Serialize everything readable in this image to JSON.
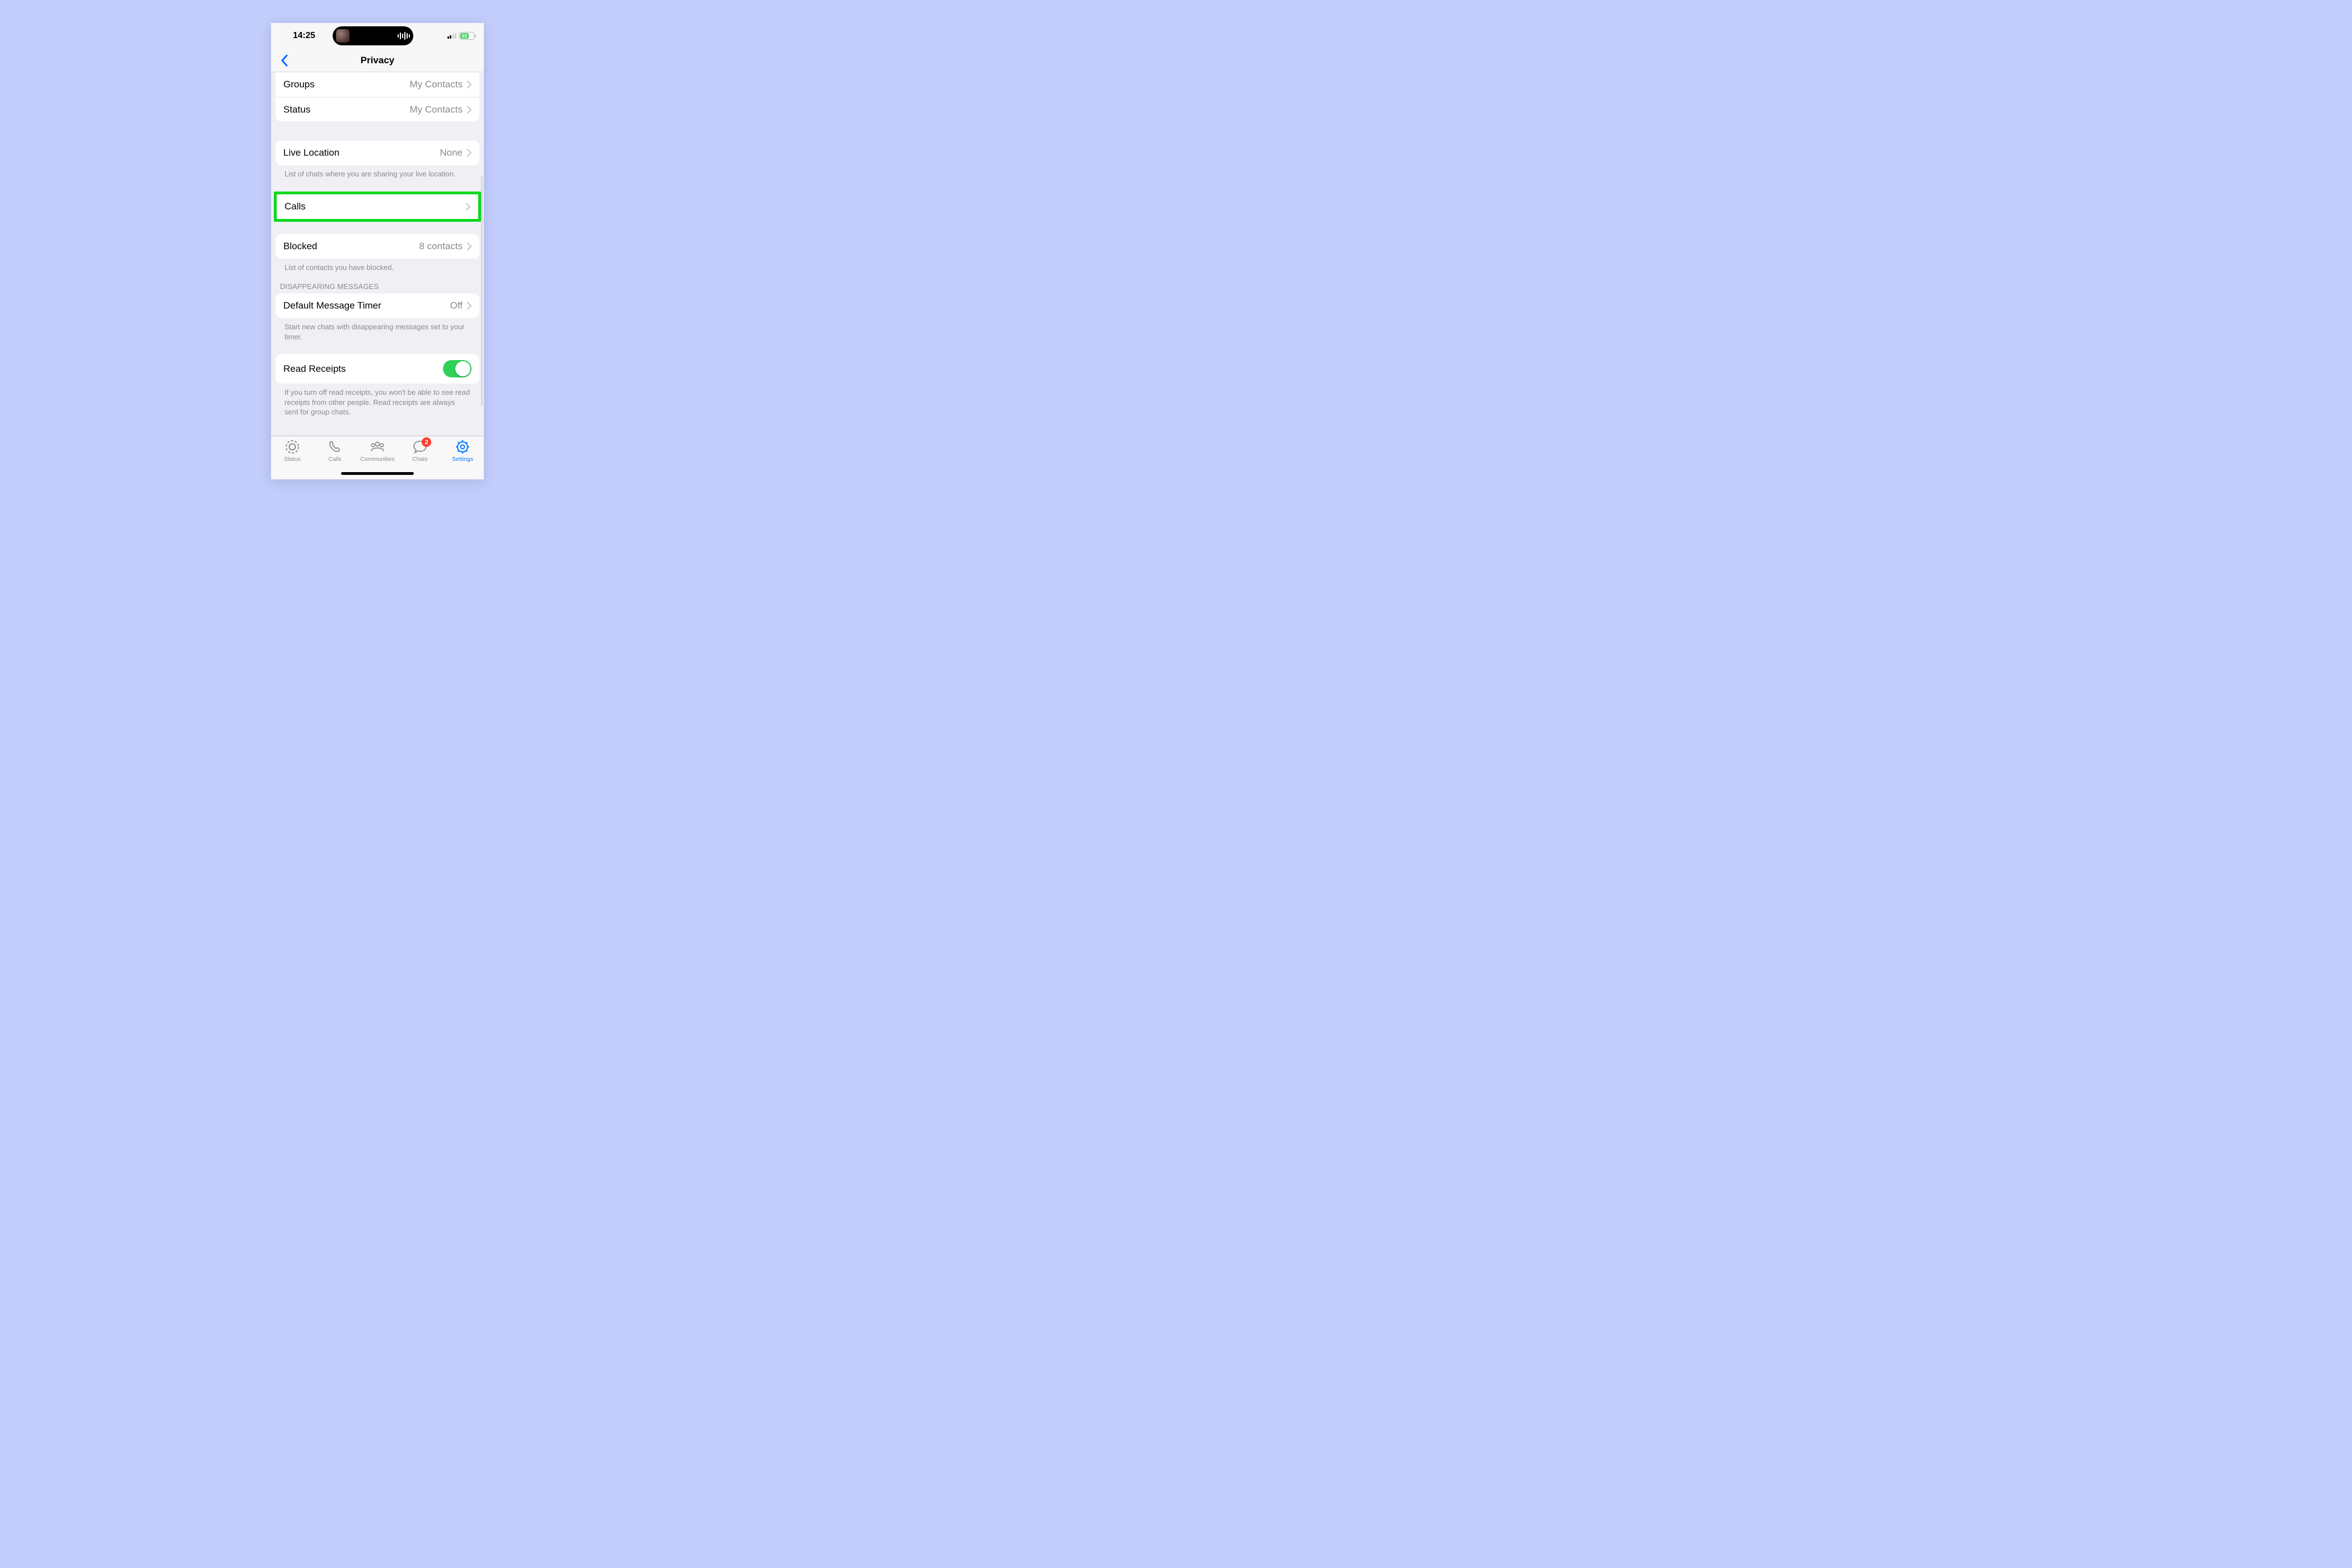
{
  "status": {
    "time": "14:25",
    "battery_pct": "60"
  },
  "nav": {
    "title": "Privacy"
  },
  "rows": {
    "groups": {
      "label": "Groups",
      "value": "My Contacts"
    },
    "status": {
      "label": "Status",
      "value": "My Contacts"
    },
    "livelocation": {
      "label": "Live Location",
      "value": "None"
    },
    "calls": {
      "label": "Calls",
      "value": ""
    },
    "blocked": {
      "label": "Blocked",
      "value": "8 contacts"
    },
    "dmt": {
      "label": "Default Message Timer",
      "value": "Off"
    },
    "readreceipts": {
      "label": "Read Receipts"
    }
  },
  "footers": {
    "livelocation": "List of chats where you are sharing your live location.",
    "blocked": "List of contacts you have blocked.",
    "dmt": "Start new chats with disappearing messages set to your timer.",
    "readreceipts": "If you turn off read receipts, you won't be able to see read receipts from other people. Read receipts are always sent for group chats."
  },
  "headers": {
    "disappearing": "Disappearing Messages"
  },
  "tabs": {
    "status": "Status",
    "calls": "Calls",
    "communities": "Communities",
    "chats": "Chats",
    "settings": "Settings",
    "chats_badge": "2"
  }
}
